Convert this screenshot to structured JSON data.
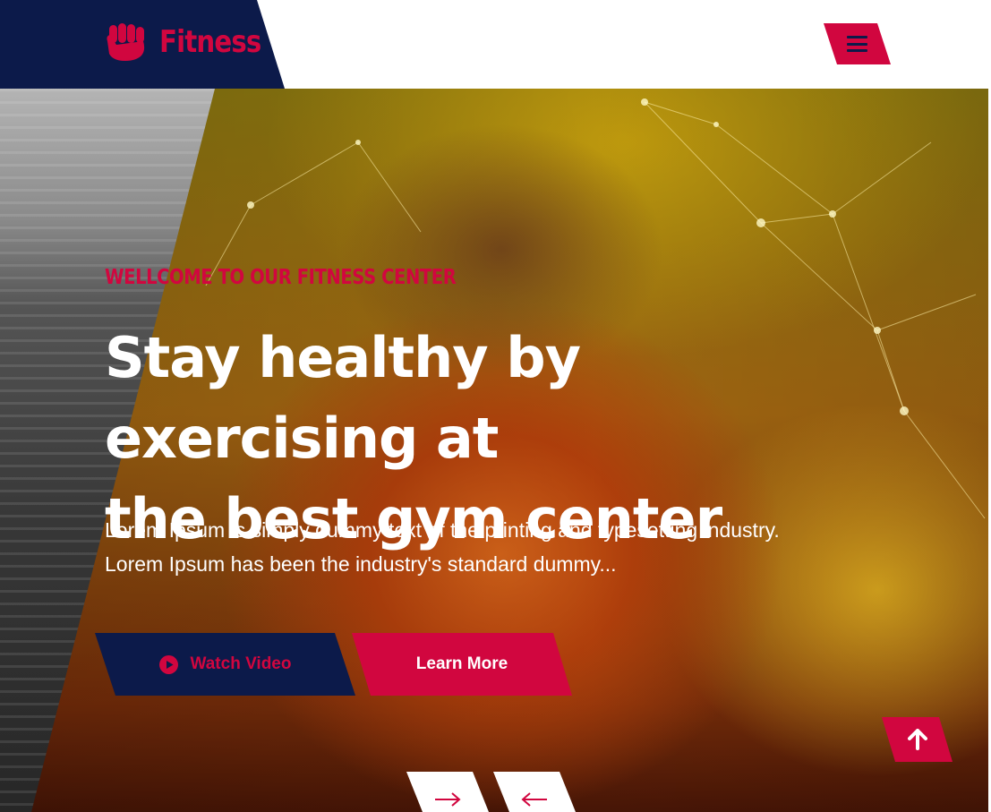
{
  "header": {
    "brand": "Fitness",
    "logo_icon": "fist-icon",
    "menu_icon": "hamburger-menu-icon"
  },
  "hero": {
    "tagline": "WELLCOME TO OUR FITNESS CENTER",
    "title_line1": "Stay healthy by exercising at",
    "title_line2": "the best gym center",
    "desc_line1": "Lorem Ipsum is simply dummy text of the printing and typesetting industry.",
    "desc_line2": "Lorem Ipsum has been the industry's standard dummy...",
    "watch_label": "Watch Video",
    "watch_icon": "play-circle-icon",
    "learn_label": "Learn More"
  },
  "controls": {
    "scroll_top_icon": "arrow-up-icon",
    "next_icon": "arrow-right-icon",
    "prev_icon": "arrow-left-icon"
  },
  "colors": {
    "navy": "#0c1a4a",
    "accent": "#d1063f",
    "white": "#ffffff"
  }
}
